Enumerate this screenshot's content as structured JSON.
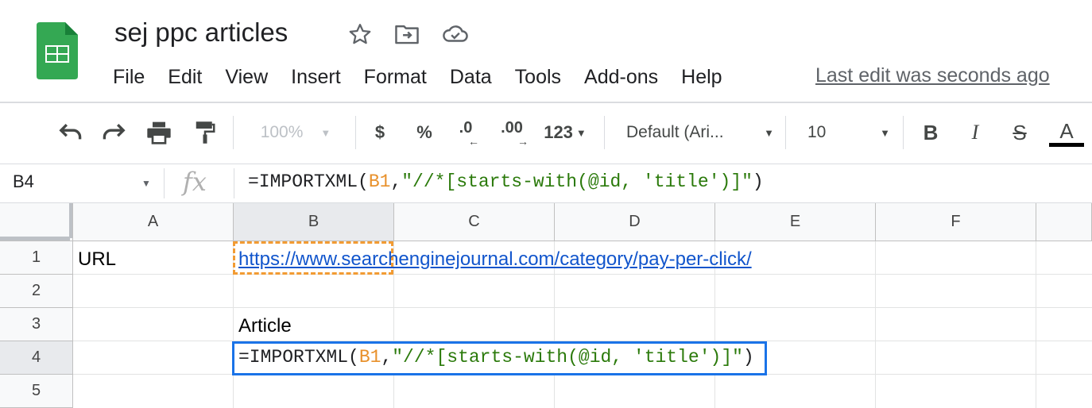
{
  "doc": {
    "title": "sej ppc articles",
    "last_edit": "Last edit was seconds ago"
  },
  "menu": [
    "File",
    "Edit",
    "View",
    "Insert",
    "Format",
    "Data",
    "Tools",
    "Add-ons",
    "Help"
  ],
  "toolbar": {
    "zoom": "100%",
    "currency": "$",
    "percent": "%",
    "decrease_decimal": ".0",
    "increase_decimal": ".00",
    "more_formats": "123",
    "font": "Default (Ari...",
    "font_size": "10",
    "bold": "B",
    "italic": "I",
    "strikethrough": "S",
    "text_color": "A"
  },
  "formula_bar": {
    "name_box": "B4",
    "fx": "fx",
    "formula_prefix": "=IMPORTXML(",
    "formula_ref": "B1",
    "formula_sep": ",",
    "formula_string": "\"//*[starts-with(@id, 'title')]\"",
    "formula_suffix": ")"
  },
  "grid": {
    "columns": [
      "A",
      "B",
      "C",
      "D",
      "E",
      "F"
    ],
    "rows": [
      "1",
      "2",
      "3",
      "4",
      "5"
    ],
    "cells": {
      "A1": "URL",
      "B1": "https://www.searchenginejournal.com/category/pay-per-click/",
      "B3": "Article"
    },
    "selected_cell": "B4"
  },
  "colors": {
    "accent_blue": "#1a73e8",
    "copy_border": "#f29b33",
    "ref_orange": "#e8912c",
    "string_green": "#2b7a0b",
    "sheets_green": "#34a853",
    "link_blue": "#1155cc"
  }
}
